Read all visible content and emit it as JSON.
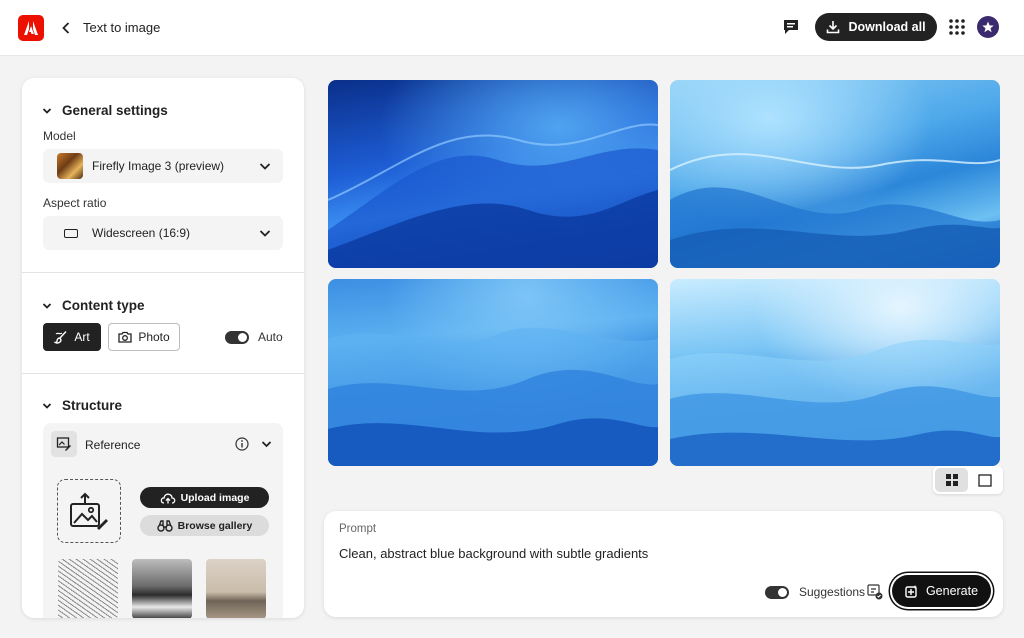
{
  "header": {
    "page_title": "Text to image",
    "download_label": "Download all",
    "brand_color": "#eb1000"
  },
  "settings": {
    "general_title": "General settings",
    "model_label": "Model",
    "model_value": "Firefly Image 3 (preview)",
    "aspect_label": "Aspect ratio",
    "aspect_value": "Widescreen (16:9)"
  },
  "content_type": {
    "title": "Content type",
    "options": [
      "Art",
      "Photo"
    ],
    "selected": "Art",
    "auto_label": "Auto",
    "auto_on": true
  },
  "structure": {
    "title": "Structure",
    "reference_label": "Reference",
    "upload_label": "Upload image",
    "gallery_label": "Browse gallery"
  },
  "gallery": {
    "images": [
      "generated-image-1",
      "generated-image-2",
      "generated-image-3",
      "generated-image-4"
    ],
    "view_mode": "grid"
  },
  "prompt": {
    "label": "Prompt",
    "text": "Clean, abstract blue background with subtle gradients",
    "suggestions_label": "Suggestions",
    "suggestions_on": true,
    "generate_label": "Generate"
  },
  "icons": {
    "logo": "adobe-logo-icon",
    "back": "chevron-left-icon",
    "chat": "chat-icon",
    "download": "download-icon",
    "apps": "apps-grid-icon",
    "avatar": "avatar-icon"
  }
}
